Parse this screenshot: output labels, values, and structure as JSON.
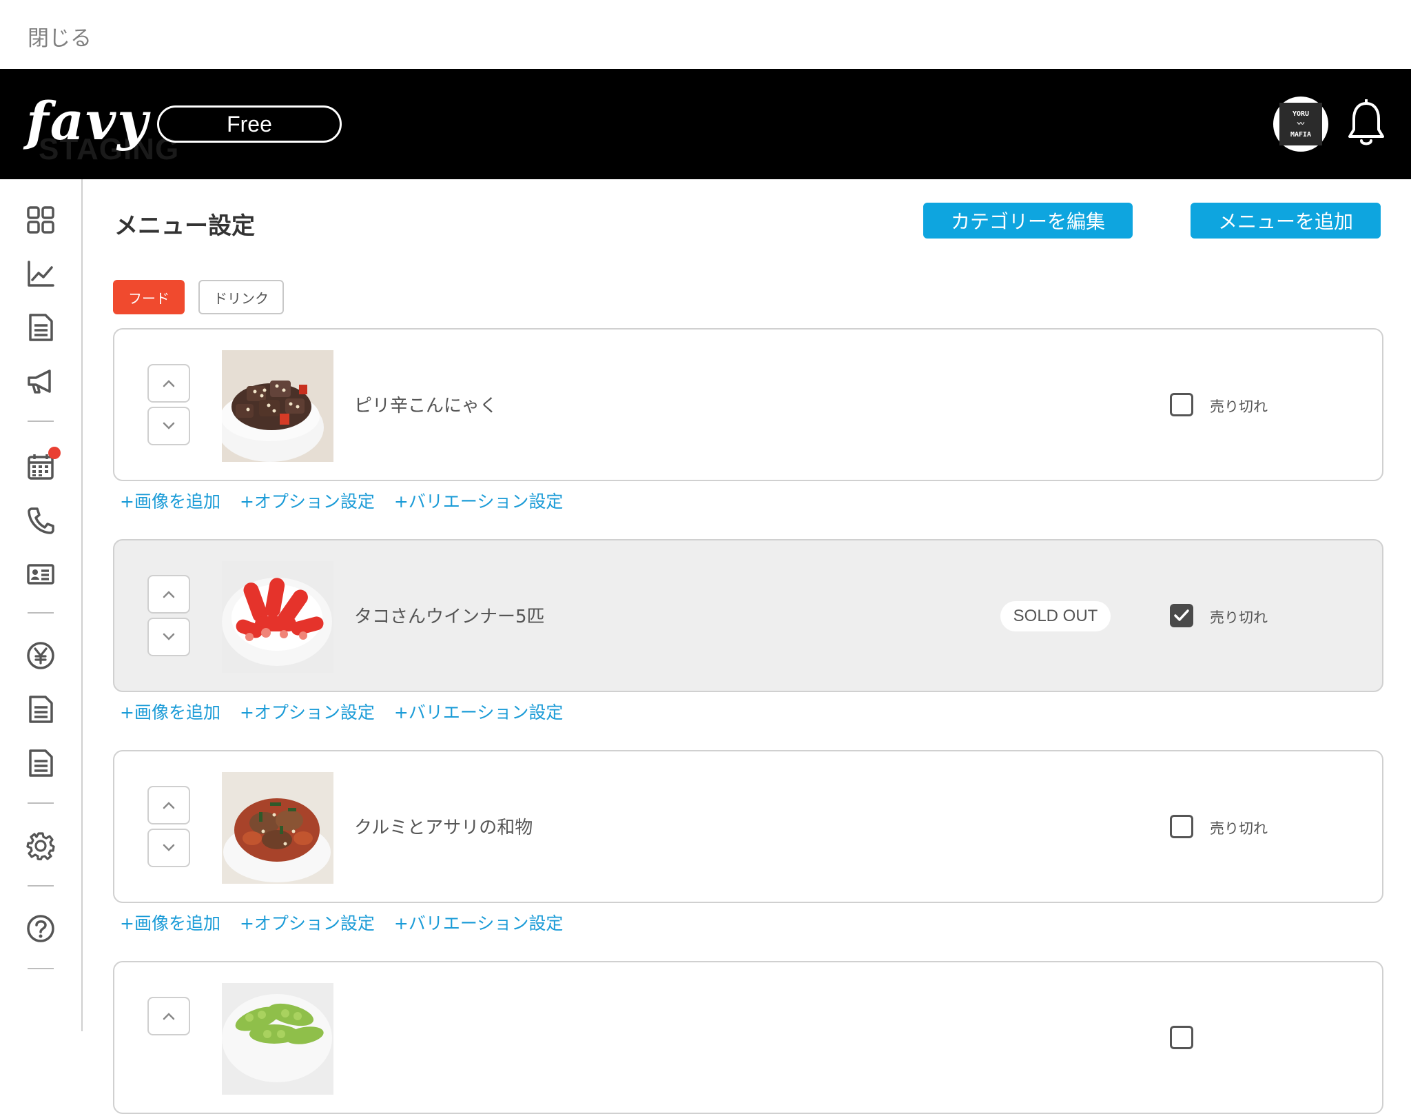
{
  "topbar": {
    "close_label": "閉じる"
  },
  "header": {
    "staging_label": "STAGING",
    "logo_text": "favy",
    "plan_label": "Free",
    "avatar_lines": [
      "YORU",
      "MAFIA"
    ]
  },
  "page": {
    "title": "メニュー設定",
    "edit_category_label": "カテゴリーを編集",
    "add_menu_label": "メニューを追加"
  },
  "tabs": [
    {
      "label": "フード",
      "active": true
    },
    {
      "label": "ドリンク",
      "active": false
    }
  ],
  "items": [
    {
      "name": "ピリ辛こんにゃく",
      "sold_out": false,
      "sold_out_label": "売り切れ",
      "badge": ""
    },
    {
      "name": "タコさんウインナー5匹",
      "sold_out": true,
      "sold_out_label": "売り切れ",
      "badge": "SOLD OUT"
    },
    {
      "name": "クルミとアサリの和物",
      "sold_out": false,
      "sold_out_label": "売り切れ",
      "badge": ""
    },
    {
      "name": "",
      "sold_out": false,
      "sold_out_label": "",
      "badge": ""
    }
  ],
  "item_links": {
    "add_image": "+画像を追加",
    "option_settings": "+オプション設定",
    "variation_settings": "+バリエーション設定"
  },
  "colors": {
    "accent_blue": "#0ea5df",
    "link_blue": "#1a9bd7",
    "active_tab": "#f04a2e",
    "notification_dot": "#e94033",
    "header_bg": "#000000"
  },
  "sidebar_icons": [
    "dashboard-icon",
    "analytics-icon",
    "document-icon",
    "megaphone-icon",
    "calendar-icon",
    "phone-icon",
    "id-card-icon",
    "yen-icon",
    "report-icon",
    "invoice-icon",
    "settings-icon",
    "help-icon"
  ]
}
